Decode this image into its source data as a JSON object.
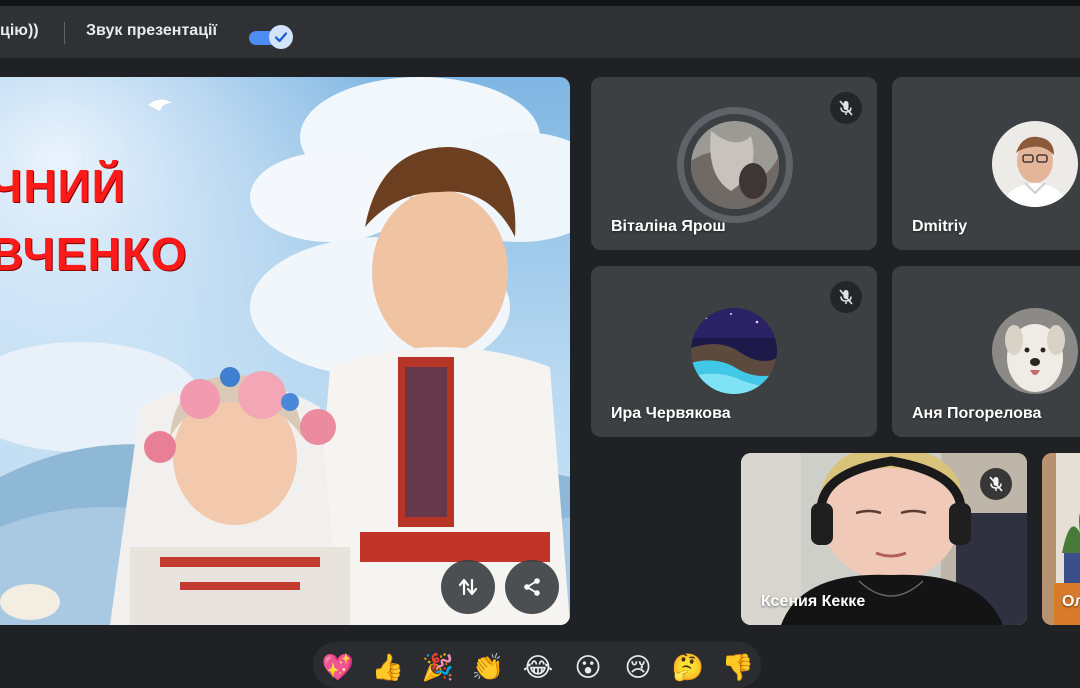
{
  "topbar": {
    "partial_text": "цію))",
    "sound_label": "Звук презентації",
    "sound_enabled": true,
    "accent_color": "#4d8cf5"
  },
  "presentation": {
    "title_line1": "ЧНИЙ",
    "title_line2": "ВЧЕНКО",
    "buttons": [
      {
        "icon": "swap-vertical-icon"
      },
      {
        "icon": "share-icon"
      }
    ]
  },
  "participants": [
    {
      "name": "Віталіна Ярош",
      "muted": true
    },
    {
      "name": "Dmitriy",
      "muted": false
    },
    {
      "name": "Ира Червякова",
      "muted": true
    },
    {
      "name": "Аня Погорелова",
      "muted": false
    },
    {
      "name": "Ксения Кекке",
      "muted": true
    },
    {
      "name": "Ол",
      "muted": false
    }
  ],
  "reactions": [
    "💖",
    "👍",
    "🎉",
    "👏",
    "😂",
    "😮",
    "😢",
    "🤔",
    "👎"
  ]
}
